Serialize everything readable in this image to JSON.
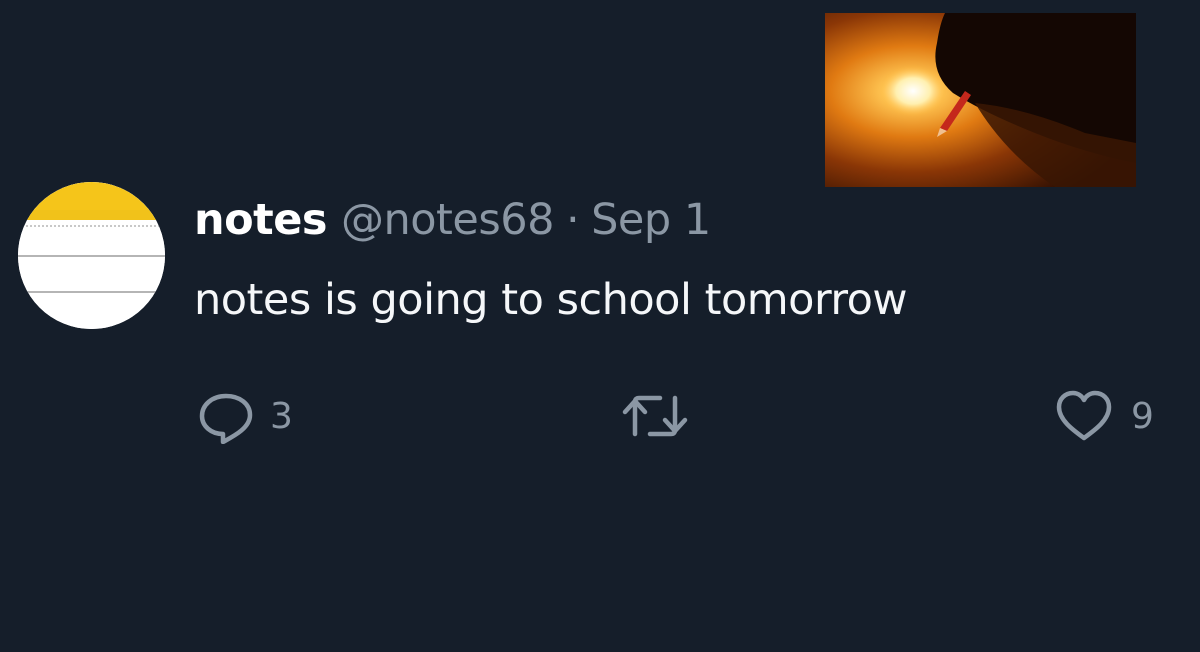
{
  "tweet": {
    "display_name": "notes",
    "handle": "@notes68",
    "separator": "·",
    "date": "Sep 1",
    "text": "notes is going to school tomorrow"
  },
  "actions": {
    "reply_count": "3",
    "like_count": "9"
  },
  "icons": {
    "reply": "speech-bubble-icon",
    "retweet": "retweet-arrows-icon",
    "like": "heart-icon"
  },
  "colors": {
    "background": "#151e2a",
    "muted_text": "#8b97a4",
    "avatar_top": "#f5c51a"
  }
}
